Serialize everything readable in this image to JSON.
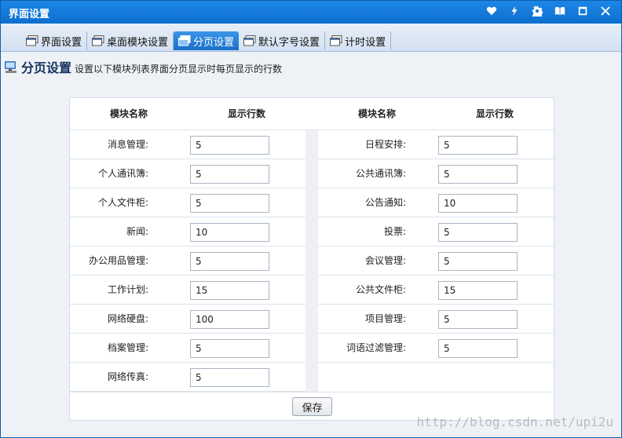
{
  "window": {
    "title": "界面设置"
  },
  "tabs": [
    {
      "label": "界面设置",
      "active": false
    },
    {
      "label": "桌面模块设置",
      "active": false
    },
    {
      "label": "分页设置",
      "active": true
    },
    {
      "label": "默认字号设置",
      "active": false
    },
    {
      "label": "计时设置",
      "active": false
    }
  ],
  "heading": {
    "title": "分页设置",
    "description": "设置以下模块列表界面分页显示时每页显示的行数"
  },
  "table": {
    "col_module": "模块名称",
    "col_rows": "显示行数",
    "left": [
      {
        "label": "消息管理:",
        "value": "5"
      },
      {
        "label": "个人通讯簿:",
        "value": "5"
      },
      {
        "label": "个人文件柜:",
        "value": "5"
      },
      {
        "label": "新闻:",
        "value": "10"
      },
      {
        "label": "办公用品管理:",
        "value": "5"
      },
      {
        "label": "工作计划:",
        "value": "15"
      },
      {
        "label": "网络硬盘:",
        "value": "100"
      },
      {
        "label": "档案管理:",
        "value": "5"
      },
      {
        "label": "网络传真:",
        "value": "5"
      }
    ],
    "right": [
      {
        "label": "日程安排:",
        "value": "5"
      },
      {
        "label": "公共通讯簿:",
        "value": "5"
      },
      {
        "label": "公告通知:",
        "value": "10"
      },
      {
        "label": "投票:",
        "value": "5"
      },
      {
        "label": "会议管理:",
        "value": "5"
      },
      {
        "label": "公共文件柜:",
        "value": "15"
      },
      {
        "label": "项目管理:",
        "value": "5"
      },
      {
        "label": "词语过滤管理:",
        "value": "5"
      }
    ]
  },
  "save_label": "保存",
  "watermark": "http://blog.csdn.net/upi2u",
  "colors": {
    "titlebar": "#0d6fcf",
    "active_tab": "#1b6fc8",
    "heading": "#14315c"
  }
}
